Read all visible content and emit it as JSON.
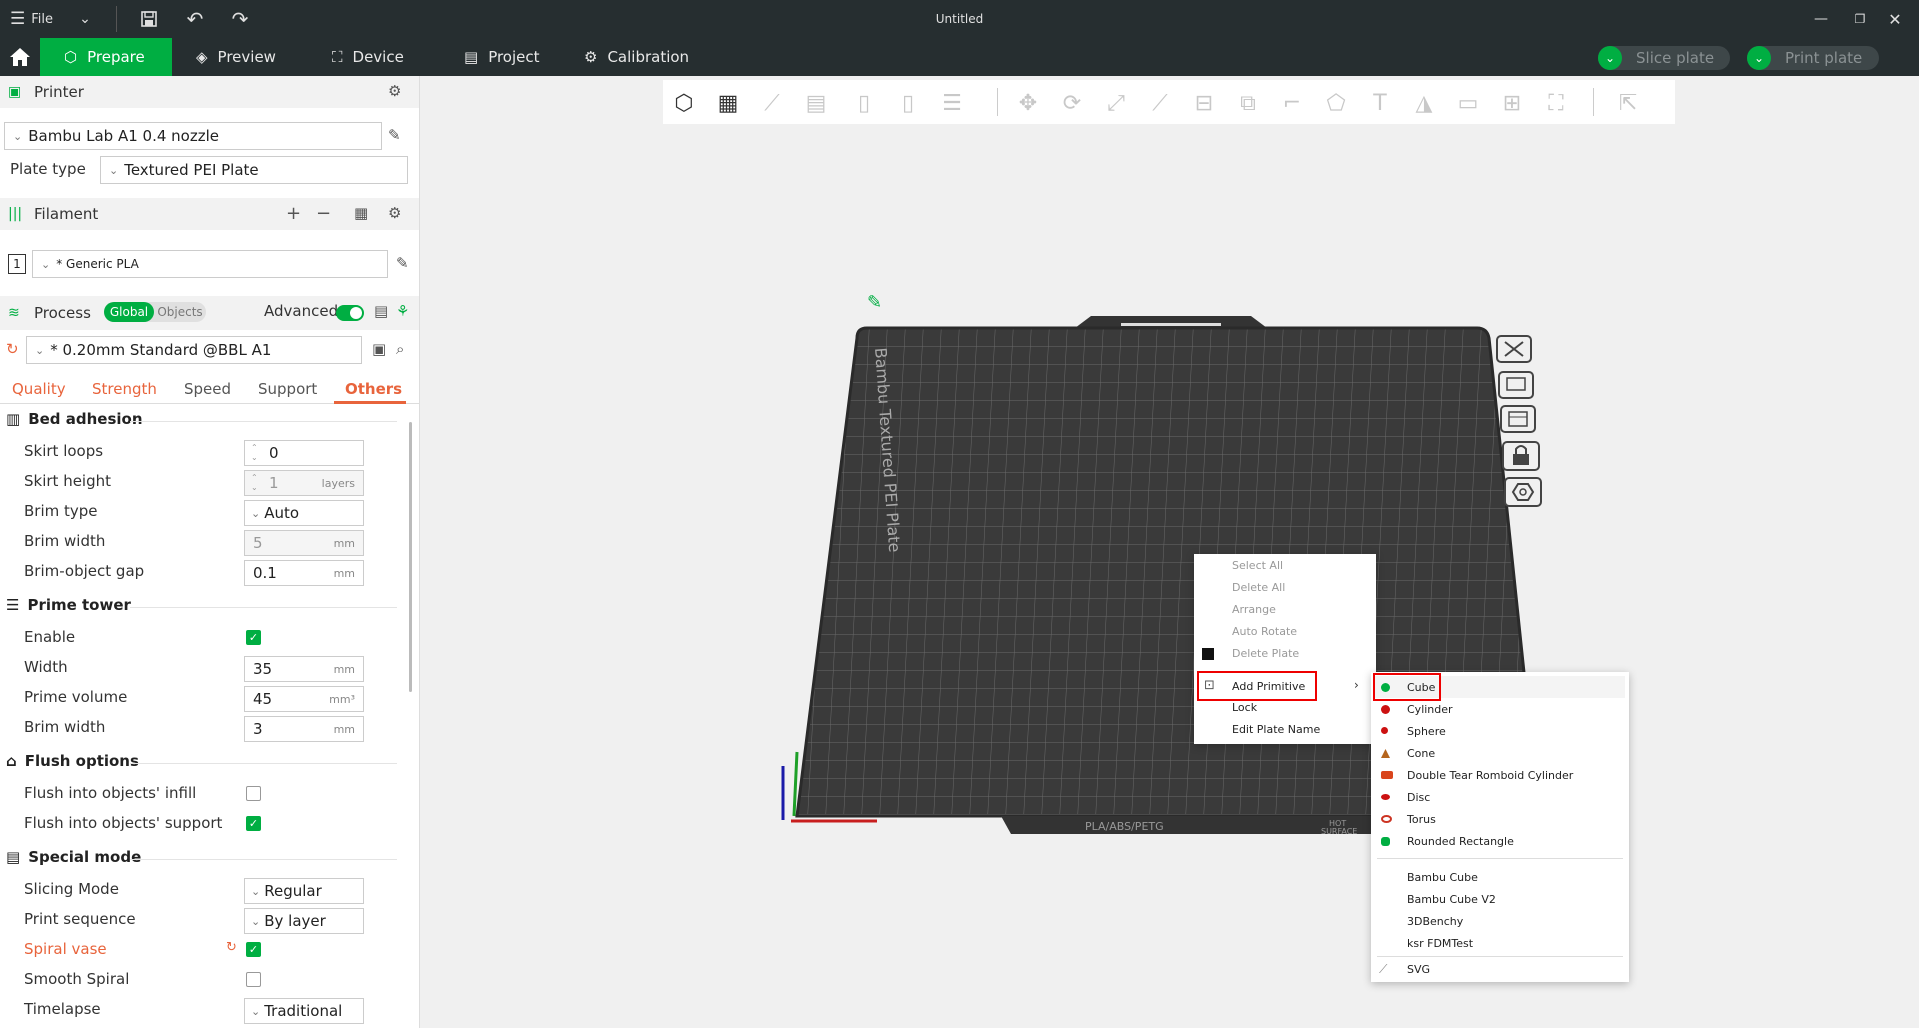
{
  "titlebar": {
    "file_label": "File",
    "window_title": "Untitled"
  },
  "nav": {
    "tabs": [
      {
        "label": "Prepare"
      },
      {
        "label": "Preview"
      },
      {
        "label": "Device"
      },
      {
        "label": "Project"
      },
      {
        "label": "Calibration"
      }
    ],
    "slice_label": "Slice plate",
    "print_label": "Print plate"
  },
  "printer": {
    "section_label": "Printer",
    "selected_printer": "Bambu Lab A1 0.4 nozzle",
    "plate_type_label": "Plate type",
    "plate_type_value": "Textured PEI Plate"
  },
  "filament": {
    "section_label": "Filament",
    "slot_number": "1",
    "selected": "* Generic PLA"
  },
  "process": {
    "section_label": "Process",
    "global_label": "Global",
    "objects_label": "Objects",
    "advanced_label": "Advanced",
    "preset": "* 0.20mm Standard @BBL A1",
    "tabs": [
      "Quality",
      "Strength",
      "Speed",
      "Support",
      "Others"
    ],
    "active_tab": "Others"
  },
  "groups": {
    "bed_adhesion": "Bed adhesion",
    "prime_tower": "Prime tower",
    "flush_options": "Flush options",
    "special_mode": "Special mode"
  },
  "options": {
    "skirt_loops": {
      "label": "Skirt loops",
      "value": "0"
    },
    "skirt_height": {
      "label": "Skirt height",
      "value": "1",
      "unit": "layers"
    },
    "brim_type": {
      "label": "Brim type",
      "value": "Auto"
    },
    "brim_width": {
      "label": "Brim width",
      "value": "5",
      "unit": "mm"
    },
    "brim_object_gap": {
      "label": "Brim-object gap",
      "value": "0.1",
      "unit": "mm"
    },
    "enable": {
      "label": "Enable",
      "checked": true
    },
    "width": {
      "label": "Width",
      "value": "35",
      "unit": "mm"
    },
    "prime_volume": {
      "label": "Prime volume",
      "value": "45",
      "unit": "mm³"
    },
    "prime_brim_width": {
      "label": "Brim width",
      "value": "3",
      "unit": "mm"
    },
    "flush_infill": {
      "label": "Flush into objects' infill",
      "checked": false
    },
    "flush_support": {
      "label": "Flush into objects' support",
      "checked": true
    },
    "slicing_mode": {
      "label": "Slicing Mode",
      "value": "Regular"
    },
    "print_sequence": {
      "label": "Print sequence",
      "value": "By layer"
    },
    "spiral_vase": {
      "label": "Spiral vase",
      "checked": true
    },
    "smooth_spiral": {
      "label": "Smooth Spiral",
      "checked": false
    },
    "timelapse": {
      "label": "Timelapse",
      "value": "Traditional"
    }
  },
  "plate": {
    "bed_label": "Bambu Textured PEI Plate",
    "material_label": "PLA/ABS/PETG",
    "hot_label": "HOT",
    "surface_label": "SURFACE"
  },
  "context_menu": {
    "items": [
      "Select All",
      "Delete All",
      "Arrange",
      "Auto Rotate",
      "Delete Plate",
      "Add Primitive",
      "Lock",
      "Edit Plate Name"
    ]
  },
  "primitive_menu": {
    "shapes": [
      "Cube",
      "Cylinder",
      "Sphere",
      "Cone",
      "Double Tear Romboid Cylinder",
      "Disc",
      "Torus",
      "Rounded Rectangle"
    ],
    "models": [
      "Bambu Cube",
      "Bambu Cube V2",
      "3DBenchy",
      "ksr FDMTest"
    ],
    "other": [
      "SVG"
    ]
  },
  "colors": {
    "accent": "#00ae42",
    "titlebar": "#262e30",
    "highlight_tab": "#e8643c",
    "bed": "#3a3a3a",
    "grid": "#6a6a6a"
  }
}
